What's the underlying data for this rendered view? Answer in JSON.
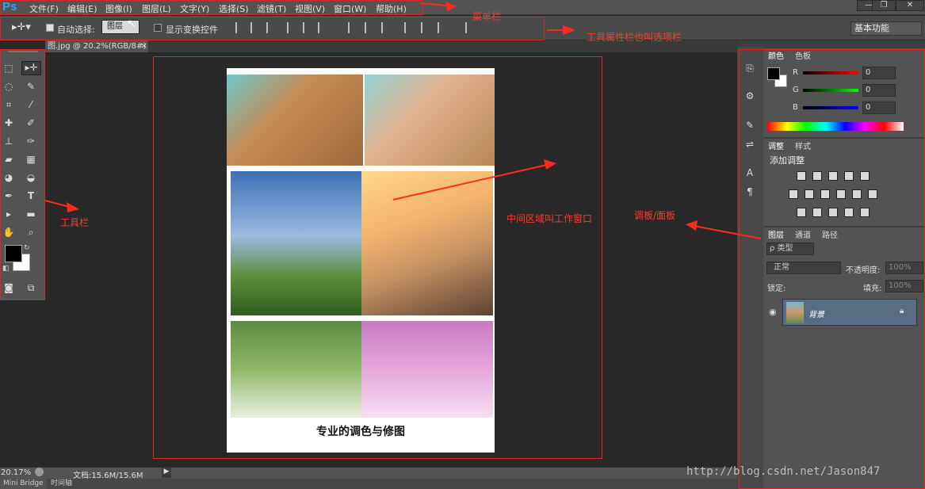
{
  "app": {
    "logo": "Ps"
  },
  "menu": [
    "文件(F)",
    "编辑(E)",
    "图像(I)",
    "图层(L)",
    "文字(Y)",
    "选择(S)",
    "滤镜(T)",
    "视图(V)",
    "窗口(W)",
    "帮助(H)"
  ],
  "window_controls": {
    "minimize": "—",
    "restore": "❐",
    "close": "✕"
  },
  "options": {
    "auto_select_label": "自动选择:",
    "auto_select_checked": true,
    "auto_select_target": "图层",
    "show_transform_label": "显示变换控件",
    "show_transform_checked": false,
    "workspace": "基本功能"
  },
  "document_tab": {
    "title": "图.jpg @ 20.2%(RGB/8#)",
    "close": "×"
  },
  "document": {
    "caption": "专业的调色与修图"
  },
  "annotations": {
    "menubar": "菜单栏",
    "optionbar": "工具属性栏也叫选项栏",
    "toolbar": "工具栏",
    "workarea": "中间区域叫工作窗口",
    "panels": "调板/面板"
  },
  "status": {
    "zoom": "20.17%",
    "doc_info": "文档:15.6M/15.6M",
    "bottom_tabs": [
      "Mini Bridge",
      "时间轴"
    ]
  },
  "color_panel": {
    "tabs": [
      "颜色",
      "色板"
    ],
    "channels": [
      {
        "label": "R",
        "value": "0"
      },
      {
        "label": "G",
        "value": "0"
      },
      {
        "label": "B",
        "value": "0"
      }
    ],
    "colors": {
      "foreground": "#000000",
      "background": "#ffffff"
    }
  },
  "adjust_panel": {
    "tabs": [
      "调整",
      "样式"
    ],
    "title": "添加调整"
  },
  "layers_panel": {
    "tabs": [
      "图层",
      "通道",
      "路径"
    ],
    "filter": "ρ 类型",
    "blend_mode": "正常",
    "opacity_label": "不透明度:",
    "opacity_value": "100%",
    "lock_label": "锁定:",
    "fill_label": "填充:",
    "fill_value": "100%",
    "layer_name": "背景"
  },
  "watermark": "http://blog.csdn.net/Jason847",
  "accent": {
    "annotation_red": "#ff2a1f",
    "layer_selected": "#5a6b84"
  }
}
